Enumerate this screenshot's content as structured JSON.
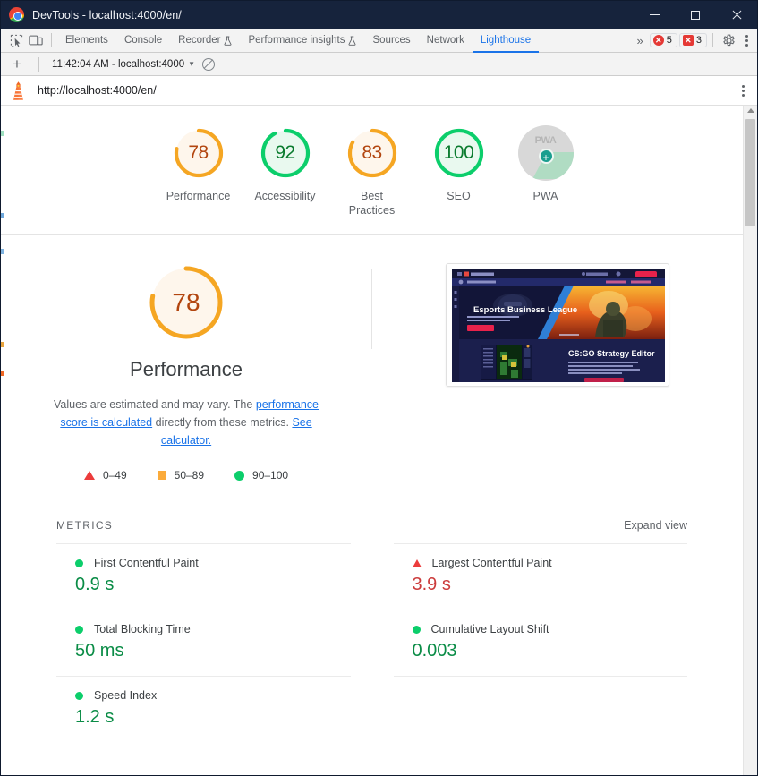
{
  "window": {
    "title": "DevTools - localhost:4000/en/",
    "logo_icon": "chrome-logo",
    "minimize_label": "Minimize",
    "maximize_label": "Maximize",
    "close_label": "Close"
  },
  "devtools": {
    "inspect_icon": "inspect-element-icon",
    "device_icon": "device-toolbar-icon",
    "tabs": [
      {
        "label": "Elements",
        "active": false,
        "icon": ""
      },
      {
        "label": "Console",
        "active": false,
        "icon": ""
      },
      {
        "label": "Recorder",
        "active": false,
        "icon": "flask-icon"
      },
      {
        "label": "Performance insights",
        "active": false,
        "icon": "flask-icon"
      },
      {
        "label": "Sources",
        "active": false,
        "icon": ""
      },
      {
        "label": "Network",
        "active": false,
        "icon": ""
      },
      {
        "label": "Lighthouse",
        "active": true,
        "icon": ""
      }
    ],
    "more_tabs_icon": "chevron-double-right-icon",
    "errors_count": "5",
    "warnings_count": "3",
    "settings_icon": "gear-icon",
    "more_options_icon": "kebab-menu-icon"
  },
  "lighthouse_toolbar": {
    "new_report_icon": "plus-icon",
    "run_selector": "11:42:04 AM - localhost:4000",
    "run_selector_caret": "chevron-down-icon",
    "clear_icon": "no-entry-icon"
  },
  "urlbar": {
    "logo_icon": "lighthouse-logo-icon",
    "url": "http://localhost:4000/en/",
    "menu_icon": "kebab-menu-icon"
  },
  "scores": [
    {
      "label": "Performance",
      "value": "78",
      "percent": 78,
      "color": "#f5a623",
      "bg": "#fef6ec",
      "text_color": "#b2450f"
    },
    {
      "label": "Accessibility",
      "value": "92",
      "percent": 92,
      "color": "#0cce6b",
      "bg": "#e9f9ef",
      "text_color": "#0a7b2e"
    },
    {
      "label": "Best\nPractices",
      "value": "83",
      "percent": 83,
      "color": "#f5a623",
      "bg": "#fef6ec",
      "text_color": "#b2450f"
    },
    {
      "label": "SEO",
      "value": "100",
      "percent": 100,
      "color": "#0cce6b",
      "bg": "#e9f9ef",
      "text_color": "#0a7b2e"
    }
  ],
  "pwa": {
    "label": "PWA",
    "badge_text": "PWA",
    "plus_icon": "pwa-plus-icon"
  },
  "performance": {
    "score": "78",
    "percent": 78,
    "title": "Performance",
    "ring_color": "#f5a623",
    "ring_bg": "#fef6ec",
    "score_color": "#b2450f",
    "description_parts": [
      {
        "text": "Values are estimated and may vary. The ",
        "link": false
      },
      {
        "text": "performance score is calculated",
        "link": true
      },
      {
        "text": " directly from these metrics. ",
        "link": false
      },
      {
        "text": "See calculator.",
        "link": true
      }
    ],
    "legend": [
      {
        "shape": "triangle",
        "label": "0–49",
        "color": "#ec3c3c"
      },
      {
        "shape": "square",
        "label": "50–89",
        "color": "#fbab3b"
      },
      {
        "shape": "circle",
        "label": "90–100",
        "color": "#0cce6b"
      }
    ]
  },
  "screenshot": {
    "alt": "page-screenshot-thumbnail",
    "site_title": "Esports Business League",
    "section_title": "CS:GO Strategy Editor"
  },
  "metrics": {
    "heading": "METRICS",
    "expand_label": "Expand view",
    "items": [
      {
        "name": "First Contentful Paint",
        "value": "0.9 s",
        "status": "good",
        "column": "left"
      },
      {
        "name": "Largest Contentful Paint",
        "value": "3.9 s",
        "status": "bad",
        "column": "right"
      },
      {
        "name": "Total Blocking Time",
        "value": "50 ms",
        "status": "good",
        "column": "left"
      },
      {
        "name": "Cumulative Layout Shift",
        "value": "0.003",
        "status": "good",
        "column": "right"
      },
      {
        "name": "Speed Index",
        "value": "1.2 s",
        "status": "good",
        "column": "left"
      }
    ]
  },
  "scrollbar": {
    "up_arrow_icon": "scroll-up-arrow-icon"
  }
}
